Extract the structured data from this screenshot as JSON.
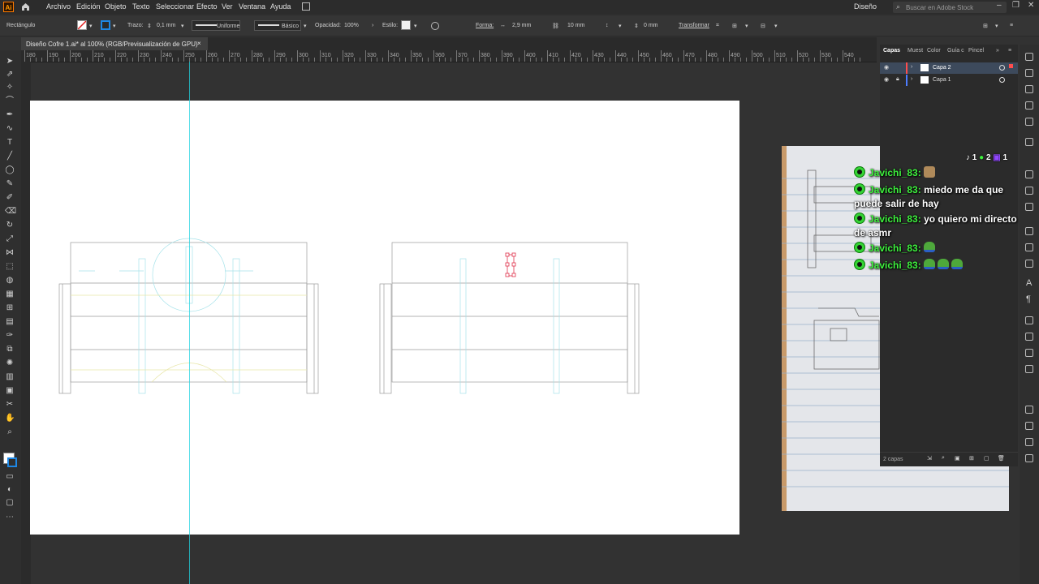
{
  "menubar": {
    "logo": "Ai",
    "items": [
      "Archivo",
      "Edición",
      "Objeto",
      "Texto",
      "Seleccionar",
      "Efecto",
      "Ver",
      "Ventana",
      "Ayuda"
    ],
    "workspace": "Diseño",
    "search_placeholder": "Buscar en Adobe Stock"
  },
  "controlbar": {
    "selection_type": "Rectángulo",
    "stroke_label": "Trazo:",
    "stroke_weight": "0,1 mm",
    "profile": "Uniforme",
    "brush": "Básico",
    "opacity_label": "Opacidad:",
    "opacity_value": "100%",
    "style_label": "Estilo:",
    "shape_label": "Forma:",
    "width_value": "2,9 mm",
    "height_value": "10 mm",
    "corner_value": "0 mm",
    "transform_label": "Transformar"
  },
  "document": {
    "tab_title": "Diseño Cofre 1.ai* al 100% (RGB/Previsualización de GPU)",
    "close": "×"
  },
  "ruler": {
    "h_ticks": [
      "180",
      "190",
      "200",
      "210",
      "220",
      "230",
      "240",
      "250",
      "260",
      "270",
      "280",
      "290",
      "300",
      "310",
      "320",
      "330",
      "340",
      "350",
      "360",
      "370",
      "380",
      "390",
      "400",
      "410",
      "420",
      "430",
      "440",
      "450",
      "460",
      "470",
      "480",
      "490",
      "500",
      "510",
      "520",
      "530",
      "540"
    ]
  },
  "layers": {
    "tabs": [
      "Capas",
      "Muest",
      "Color",
      "Guía c",
      "Pincel"
    ],
    "rows": [
      {
        "name": "Capa 2",
        "color": "#ff4d4d",
        "selected": true
      },
      {
        "name": "Capa 1",
        "color": "#4d7cff",
        "selected": false
      }
    ],
    "footer_count": "2 capas"
  },
  "chat": {
    "stats": {
      "tiktok": "1",
      "kick": "2",
      "twitch": "1"
    },
    "messages": [
      {
        "user": "Javichi_83:",
        "text": "",
        "emotes": [
          "cat"
        ]
      },
      {
        "user": "Javichi_83:",
        "text": "miedo me da que puede salir de hay",
        "emotes": []
      },
      {
        "user": "Javichi_83:",
        "text": "yo quiero mi directo de asmr",
        "emotes": []
      },
      {
        "user": "Javichi_83:",
        "text": "",
        "emotes": [
          "frog"
        ]
      },
      {
        "user": "Javichi_83:",
        "text": "",
        "emotes": [
          "frog",
          "frog",
          "frog"
        ]
      }
    ]
  },
  "colors": {
    "ui_bg": "#323232",
    "accent": "#1473e6",
    "chat_user": "#3ef23e",
    "guide": "#7fdde6"
  }
}
